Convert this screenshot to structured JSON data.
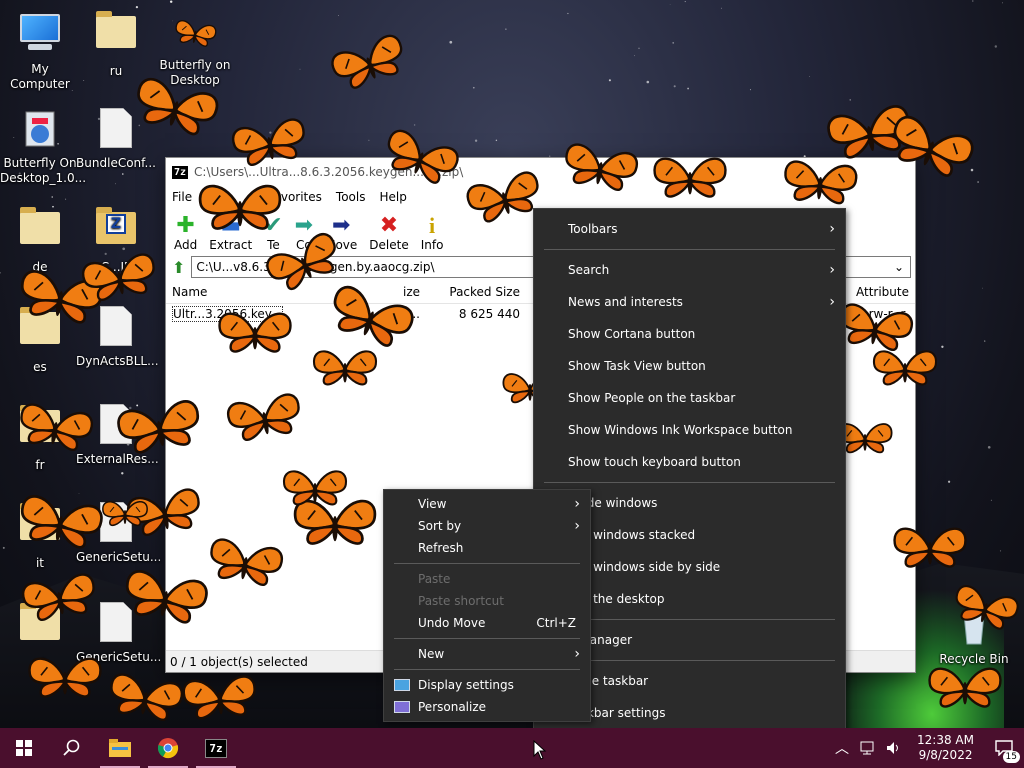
{
  "desktop_icons": [
    {
      "label": "My Computer",
      "icon": "computer-icon"
    },
    {
      "label": "ru",
      "icon": "document-icon"
    },
    {
      "label": "Butterfly on Desktop",
      "icon": "shortcut-icon"
    },
    {
      "label": "Butterfly On Desktop_1.0...",
      "icon": "installer-icon"
    },
    {
      "label": "BundleConf...",
      "icon": "document-icon"
    },
    {
      "label": "de",
      "icon": "document-icon"
    },
    {
      "label": "C...IP",
      "icon": "zip-folder-icon"
    },
    {
      "label": "es",
      "icon": "document-icon"
    },
    {
      "label": "DynActsBLL...",
      "icon": "document-icon"
    },
    {
      "label": "fr",
      "icon": "document-icon"
    },
    {
      "label": "ExternalRes...",
      "icon": "web-document-icon"
    },
    {
      "label": "it",
      "icon": "document-icon"
    },
    {
      "label": "GenericSetu...",
      "icon": "setup-icon"
    },
    {
      "label": "pt",
      "icon": "document-icon"
    },
    {
      "label": "GenericSetu...",
      "icon": "setup-icon"
    },
    {
      "label": "Recycle Bin",
      "icon": "recycle-bin-icon"
    }
  ],
  "sevenzip": {
    "title": "C:\\Users\\...Ultra...8.6.3.2056.keygen...cg.zip\\",
    "menu": [
      "File",
      "E",
      "Favorites",
      "Tools",
      "Help"
    ],
    "toolbar": [
      {
        "label": "Add",
        "icon": "add-icon"
      },
      {
        "label": "Extract",
        "icon": "extract-icon"
      },
      {
        "label": "Te",
        "icon": "test-icon"
      },
      {
        "label": "Co",
        "icon": "copy-icon"
      },
      {
        "label": "Move",
        "icon": "move-icon"
      },
      {
        "label": "Delete",
        "icon": "delete-icon"
      },
      {
        "label": "Info",
        "icon": "info-icon"
      }
    ],
    "address": "C:\\U...v8.6.3.2056.keygen.by.aaocg.zip\\",
    "columns": [
      "Name",
      "ize",
      "Packed Size",
      "Attribute"
    ],
    "rows": [
      {
        "name": "Ultr...3.2056.key...",
        "size": "8...",
        "packed": "8 625 440",
        "attr": "-rw-r--r-"
      }
    ],
    "status": "0 / 1 object(s) selected"
  },
  "taskbar_menu": {
    "items": [
      {
        "label": "Toolbars",
        "submenu": true
      },
      {
        "sep": true
      },
      {
        "label": "Search",
        "submenu": true
      },
      {
        "label": "News and interests",
        "submenu": true
      },
      {
        "label": "Show Cortana button"
      },
      {
        "label": "Show Task View button"
      },
      {
        "label": "Show People on the taskbar"
      },
      {
        "label": "Show Windows Ink Workspace button"
      },
      {
        "label": "Show touch keyboard button"
      },
      {
        "sep": true
      },
      {
        "label": "...ade windows"
      },
      {
        "label": "...w windows stacked"
      },
      {
        "label": "...w windows side by side"
      },
      {
        "label": "...w the desktop"
      },
      {
        "sep": true
      },
      {
        "label": "...Manager"
      },
      {
        "sep": true
      },
      {
        "label": "...the taskbar"
      },
      {
        "label": "Taskbar settings",
        "icon": "gear-icon"
      }
    ]
  },
  "desktop_menu": {
    "items": [
      {
        "label": "View",
        "submenu": true
      },
      {
        "label": "Sort by",
        "submenu": true
      },
      {
        "label": "Refresh"
      },
      {
        "sep": true
      },
      {
        "label": "Paste",
        "disabled": true
      },
      {
        "label": "Paste shortcut",
        "disabled": true
      },
      {
        "label": "Undo Move",
        "shortcut": "Ctrl+Z"
      },
      {
        "sep": true
      },
      {
        "label": "New",
        "submenu": true
      },
      {
        "sep": true
      },
      {
        "label": "Display settings",
        "icon": "display-settings-icon"
      },
      {
        "label": "Personalize",
        "icon": "personalize-icon"
      }
    ]
  },
  "taskbar": {
    "clock_time": "12:38 AM",
    "clock_date": "9/8/2022",
    "notification_count": "15",
    "apps": [
      "windows-start-icon",
      "search-icon",
      "file-explorer-icon",
      "chrome-icon",
      "7zip-icon"
    ]
  },
  "colors": {
    "taskbar": "#4a0f2d",
    "menu_bg": "#2b2b2b",
    "butterfly_orange": "#f07d12"
  }
}
